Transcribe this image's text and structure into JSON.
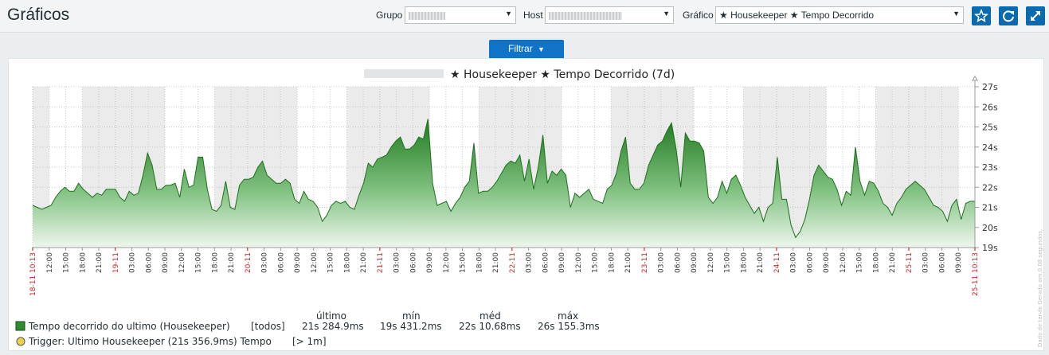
{
  "header": {
    "title": "Gráficos"
  },
  "filters": {
    "group_label": "Grupo",
    "group_value": "",
    "host_label": "Host",
    "host_value": "",
    "graph_label": "Gráfico",
    "graph_value": "★ Housekeeper ★ Tempo Decorrido"
  },
  "filter_button": {
    "label": "Filtrar"
  },
  "toolbar": {
    "icons": [
      "star-icon",
      "refresh-icon",
      "fullscreen-icon"
    ]
  },
  "graph": {
    "title_suffix": "★ Housekeeper ★ Tempo Decorrido (7d)",
    "side_text": "Dado de tends   Gerado em 0.08 segundos."
  },
  "legend": {
    "headers": [
      "último",
      "mín",
      "méd",
      "máx"
    ],
    "item1_name": "Tempo decorrido do ultimo (Housekeeper)",
    "item1_func": "[todos]",
    "item1_values": [
      "21s 284.9ms",
      "19s 431.2ms",
      "22s 10.68ms",
      "26s 155.3ms"
    ],
    "item2_name": "Trigger: Ultimo Housekeeper (21s 356.9ms) Tempo",
    "item2_cond": "[> 1m]"
  },
  "chart_data": {
    "type": "area",
    "y_ticks": [
      "19s",
      "20s",
      "21s",
      "22s",
      "23s",
      "24s",
      "25s",
      "26s",
      "27s"
    ],
    "ylim": [
      19,
      27
    ],
    "x_ticks": [
      "18-11 10:13",
      "12:00",
      "15:00",
      "18:00",
      "21:00",
      "19-11",
      "03:00",
      "06:00",
      "09:00",
      "12:00",
      "15:00",
      "18:00",
      "21:00",
      "20-11",
      "03:00",
      "06:00",
      "09:00",
      "12:00",
      "15:00",
      "18:00",
      "21:00",
      "21-11",
      "03:00",
      "06:00",
      "09:00",
      "12:00",
      "15:00",
      "18:00",
      "21:00",
      "22-11",
      "03:00",
      "06:00",
      "09:00",
      "12:00",
      "15:00",
      "18:00",
      "21:00",
      "23-11",
      "03:00",
      "06:00",
      "09:00",
      "12:00",
      "15:00",
      "18:00",
      "21:00",
      "24-11",
      "03:00",
      "06:00",
      "09:00",
      "12:00",
      "15:00",
      "18:00",
      "21:00",
      "25-11",
      "03:00",
      "06:00",
      "09:00",
      "25-11 10:13"
    ],
    "series": [
      {
        "name": "Tempo decorrido do ultimo (Housekeeper)",
        "color": "#2e8b2e",
        "values": [
          21.1,
          21.0,
          20.9,
          21.0,
          21.1,
          21.5,
          21.8,
          22.0,
          21.8,
          21.8,
          22.2,
          21.9,
          21.7,
          21.5,
          21.7,
          21.6,
          21.9,
          21.9,
          21.9,
          21.5,
          21.3,
          21.8,
          21.6,
          21.7,
          22.6,
          23.7,
          23.1,
          21.9,
          21.9,
          22.1,
          22.1,
          22.2,
          21.5,
          22.9,
          22.0,
          22.1,
          23.5,
          23.5,
          21.9,
          20.9,
          20.8,
          21.1,
          22.3,
          21.0,
          20.9,
          22.1,
          22.4,
          22.4,
          22.5,
          23.0,
          23.3,
          22.6,
          22.4,
          22.2,
          22.2,
          22.4,
          22.2,
          21.4,
          21.2,
          21.8,
          21.4,
          21.3,
          21.0,
          20.3,
          20.6,
          21.1,
          21.3,
          21.2,
          21.3,
          21.0,
          20.9,
          21.6,
          22.2,
          23.2,
          23.0,
          23.4,
          23.5,
          23.6,
          24.0,
          24.3,
          24.5,
          23.9,
          23.9,
          24.1,
          24.5,
          24.4,
          25.4,
          22.2,
          21.1,
          21.2,
          21.3,
          20.8,
          21.2,
          21.5,
          22.0,
          22.3,
          24.2,
          21.7,
          21.8,
          21.8,
          22.0,
          22.3,
          22.7,
          23.1,
          23.3,
          23.2,
          23.6,
          22.3,
          23.4,
          21.9,
          23.0,
          24.6,
          22.2,
          22.8,
          22.6,
          22.9,
          22.6,
          21.0,
          21.7,
          21.5,
          21.7,
          21.9,
          21.4,
          21.3,
          21.2,
          21.9,
          22.1,
          22.7,
          23.8,
          24.5,
          22.2,
          21.9,
          21.9,
          22.2,
          23.1,
          23.6,
          24.1,
          24.3,
          24.8,
          25.2,
          23.9,
          22.0,
          24.7,
          24.3,
          24.3,
          24.2,
          23.8,
          21.5,
          21.2,
          21.5,
          22.3,
          21.7,
          22.4,
          22.6,
          22.1,
          21.5,
          21.1,
          20.7,
          21.0,
          20.3,
          21.0,
          21.2,
          23.5,
          21.4,
          21.4,
          20.1,
          19.5,
          19.8,
          20.4,
          21.4,
          22.6,
          23.1,
          22.8,
          22.5,
          22.4,
          21.9,
          21.1,
          21.8,
          21.6,
          24.0,
          22.3,
          21.6,
          22.3,
          22.2,
          21.8,
          21.2,
          21.0,
          20.6,
          21.2,
          21.5,
          21.9,
          22.1,
          22.3,
          22.1,
          21.9,
          21.5,
          21.1,
          21.0,
          20.8,
          20.3,
          21.1,
          21.4,
          20.4,
          21.2,
          21.3,
          21.3
        ]
      }
    ],
    "grid": true
  }
}
